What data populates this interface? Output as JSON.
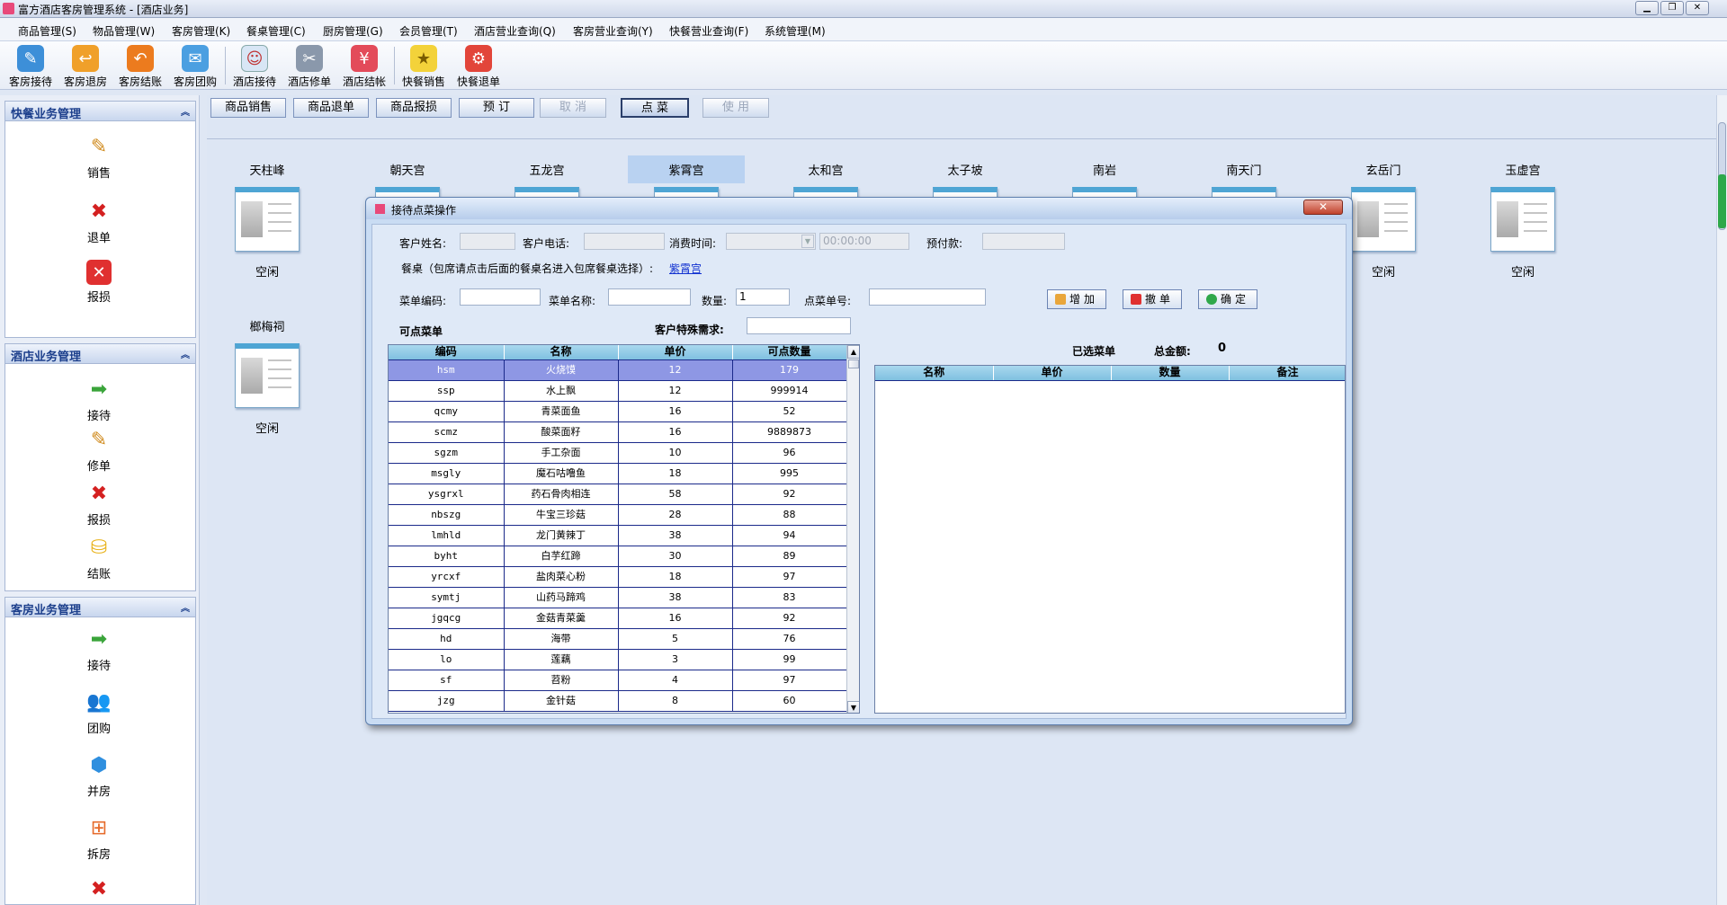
{
  "window": {
    "title": "富方酒店客房管理系统 - [酒店业务]"
  },
  "menu": [
    "商品管理(S)",
    "物品管理(W)",
    "客房管理(K)",
    "餐桌管理(C)",
    "厨房管理(G)",
    "会员管理(T)",
    "酒店营业查询(Q)",
    "客房营业查询(Y)",
    "快餐营业查询(F)",
    "系统管理(M)"
  ],
  "toolbar": [
    "客房接待",
    "客房退房",
    "客房结账",
    "客房团购",
    "酒店接待",
    "酒店修单",
    "酒店结帐",
    "快餐销售",
    "快餐退单"
  ],
  "left": {
    "fast": {
      "title": "快餐业务管理",
      "items": [
        "销售",
        "退单",
        "报损"
      ]
    },
    "hotel": {
      "title": "酒店业务管理",
      "items": [
        "接待",
        "修单",
        "报损",
        "结账"
      ]
    },
    "room": {
      "title": "客房业务管理",
      "items": [
        "接待",
        "团购",
        "并房",
        "拆房"
      ]
    }
  },
  "main_buttons": [
    "商品销售",
    "商品退单",
    "商品报损",
    "预 订",
    "取 消",
    "点 菜",
    "使 用"
  ],
  "rooms": [
    {
      "name": "天柱峰",
      "status": "空闲"
    },
    {
      "name": "朝天宫",
      "status": ""
    },
    {
      "name": "五龙宫",
      "status": ""
    },
    {
      "name": "紫霄宫",
      "status": ""
    },
    {
      "name": "太和宫",
      "status": ""
    },
    {
      "name": "太子坡",
      "status": ""
    },
    {
      "name": "南岩",
      "status": ""
    },
    {
      "name": "南天门",
      "status": ""
    },
    {
      "name": "玄岳门",
      "status": "空闲"
    },
    {
      "name": "玉虚宫",
      "status": "空闲"
    },
    {
      "name": "榔梅祠",
      "status": "空闲"
    }
  ],
  "dialog": {
    "title": "接待点菜操作",
    "close": "✕",
    "customer_name_label": "客户姓名:",
    "customer_phone_label": "客户电话:",
    "time_label": "消费时间:",
    "time_value": "00:00:00",
    "prepay_label": "预付款:",
    "table_hint": "餐桌（包席请点击后面的餐桌名进入包席餐桌选择）:",
    "table_link": "紫霄宫",
    "menu_code_label": "菜单编码:",
    "menu_name_label": "菜单名称:",
    "qty_label": "数量:",
    "qty_value": "1",
    "order_no_label": "点菜单号:",
    "add_btn": "增加",
    "cancel_btn": "撤单",
    "ok_btn": "确定",
    "available_title": "可点菜单",
    "special_label": "客户特殊需求:",
    "selected_title": "已选菜单",
    "total_label": "总金额:",
    "total_value": "0",
    "left_headers": [
      "编码",
      "名称",
      "单价",
      "可点数量"
    ],
    "right_headers": [
      "名称",
      "单价",
      "数量",
      "备注"
    ],
    "rows": [
      [
        "hsm",
        "火烧馍",
        "12",
        "179"
      ],
      [
        "ssp",
        "水上飘",
        "12",
        "999914"
      ],
      [
        "qcmy",
        "青菜面鱼",
        "16",
        "52"
      ],
      [
        "scmz",
        "酸菜面籽",
        "16",
        "9889873"
      ],
      [
        "sgzm",
        "手工杂面",
        "10",
        "96"
      ],
      [
        "msgly",
        "魔石咕噜鱼",
        "18",
        "995"
      ],
      [
        "ysgrxl",
        "药石骨肉相连",
        "58",
        "92"
      ],
      [
        "nbszg",
        "牛宝三珍菇",
        "28",
        "88"
      ],
      [
        "lmhld",
        "龙门黄辣丁",
        "38",
        "94"
      ],
      [
        "byht",
        "白芋红蹄",
        "30",
        "89"
      ],
      [
        "yrcxf",
        "盐肉菜心粉",
        "18",
        "97"
      ],
      [
        "symtj",
        "山药马蹄鸡",
        "38",
        "83"
      ],
      [
        "jgqcg",
        "金菇青菜羹",
        "16",
        "92"
      ],
      [
        "hd",
        "海带",
        "5",
        "76"
      ],
      [
        "lo",
        "莲藕",
        "3",
        "99"
      ],
      [
        "sf",
        "苕粉",
        "4",
        "97"
      ],
      [
        "jzg",
        "金针菇",
        "8",
        "60"
      ]
    ]
  }
}
